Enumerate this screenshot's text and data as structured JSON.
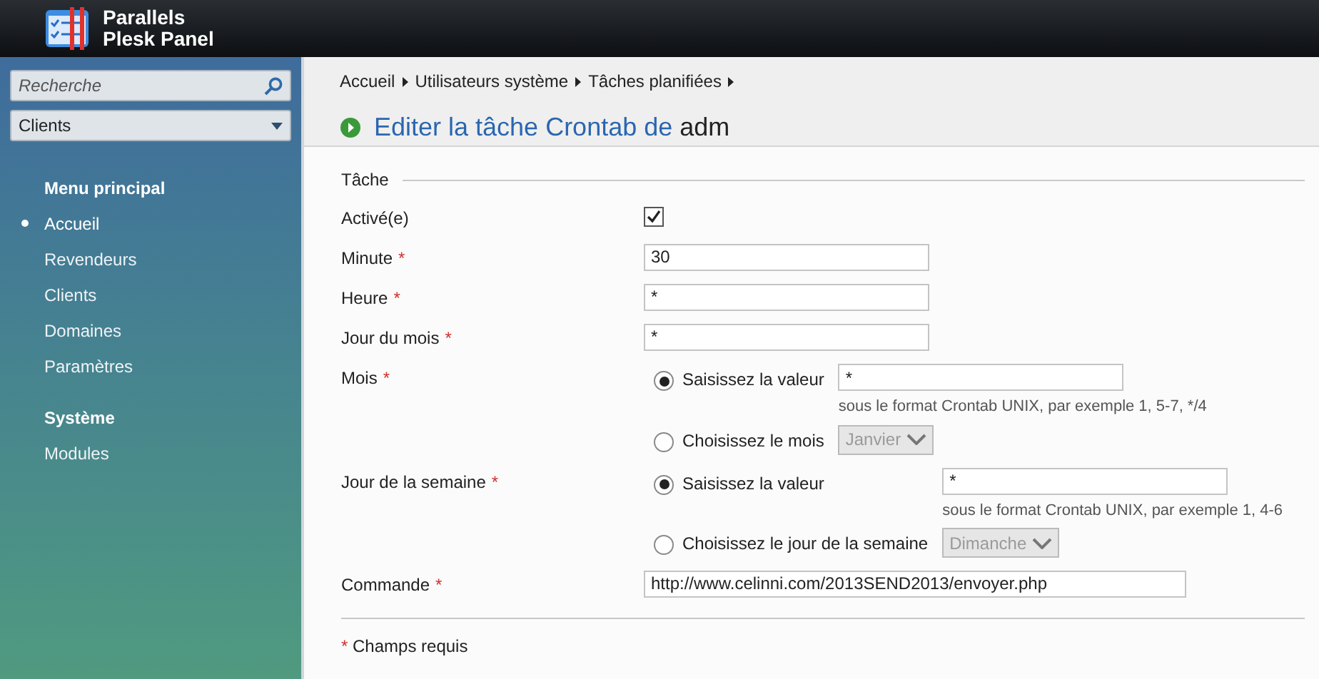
{
  "header": {
    "brand_line_1": "Parallels",
    "brand_line_2": "Plesk Panel"
  },
  "sidebar": {
    "search": {
      "placeholder": "Recherche"
    },
    "context_select": {
      "value": "Clients"
    },
    "sections": [
      {
        "title": "Menu principal",
        "items": [
          {
            "label": "Accueil",
            "selected": true
          },
          {
            "label": "Revendeurs",
            "selected": false
          },
          {
            "label": "Clients",
            "selected": false
          },
          {
            "label": "Domaines",
            "selected": false
          },
          {
            "label": "Paramètres",
            "selected": false
          }
        ]
      },
      {
        "title": "Système",
        "items": [
          {
            "label": "Modules",
            "selected": false
          }
        ]
      }
    ]
  },
  "breadcrumbs": [
    "Accueil",
    "Utilisateurs système",
    "Tâches planifiées"
  ],
  "page_title": {
    "prefix": "Editer la tâche Crontab de",
    "name": "adm"
  },
  "form": {
    "legend": "Tâche",
    "fields": [
      {
        "kind": "checkbox",
        "label": "Activé(e)",
        "checked": true
      },
      {
        "kind": "text",
        "label": "Minute",
        "required_mark": "*",
        "value": "30"
      },
      {
        "kind": "text",
        "label": "Heure",
        "required_mark": "*",
        "value": "*"
      },
      {
        "kind": "text",
        "label": "Jour du mois",
        "required_mark": "*",
        "value": "*"
      },
      {
        "kind": "radio_group",
        "label": "Mois",
        "required_mark": "*",
        "options": [
          {
            "kind": "value",
            "label": "Saisissez la valeur",
            "selected": true,
            "value": "*",
            "hint": "sous le format Crontab UNIX, par exemple 1, 5-7, */4"
          },
          {
            "kind": "select",
            "label": "Choisissez le mois",
            "selected": false,
            "value": "Janvier",
            "disabled": true
          }
        ]
      },
      {
        "kind": "radio_group",
        "label": "Jour de la semaine",
        "required_mark": "*",
        "options": [
          {
            "kind": "value",
            "label": "Saisissez la valeur",
            "selected": true,
            "value": "*",
            "hint": "sous le format Crontab UNIX, par exemple 1, 4-6"
          },
          {
            "kind": "select",
            "label": "Choisissez le jour de la semaine",
            "selected": false,
            "value": "Dimanche",
            "disabled": true
          }
        ]
      },
      {
        "kind": "wide_text",
        "label": "Commande",
        "required_mark": "*",
        "value": "http://www.celinni.com/2013SEND2013/envoyer.php"
      }
    ],
    "footer_note": {
      "mark": "*",
      "text": "Champs requis"
    }
  }
}
